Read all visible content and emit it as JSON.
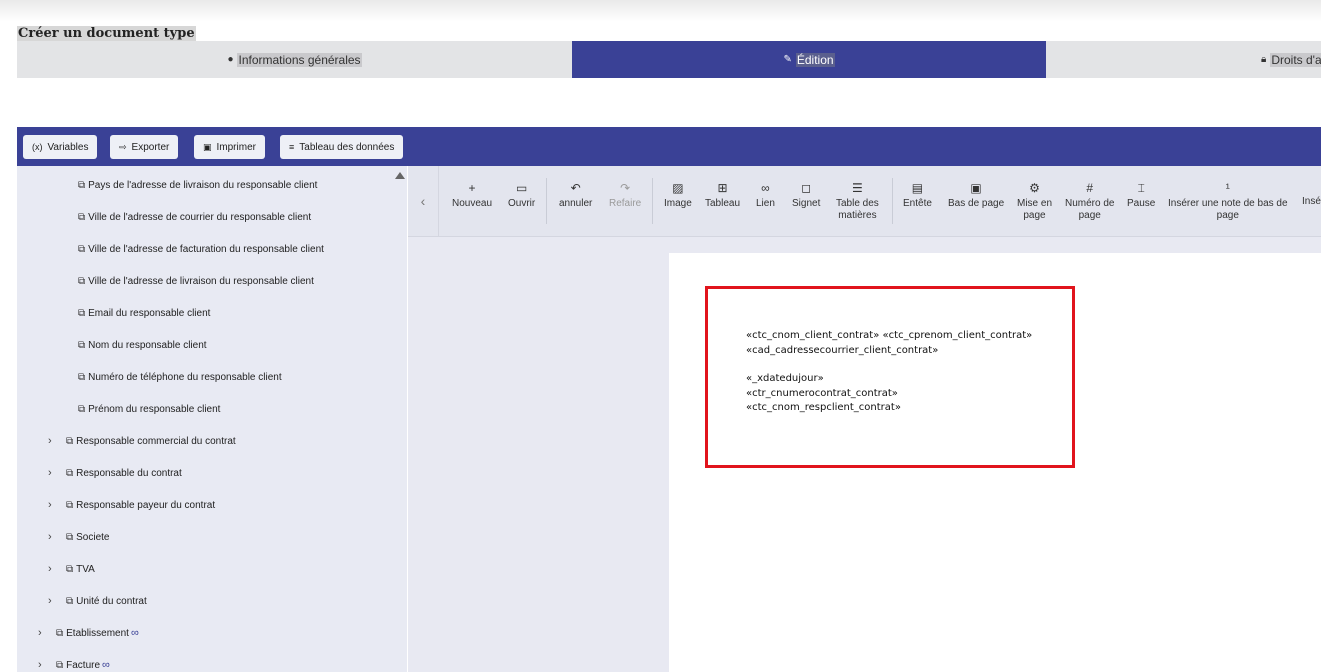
{
  "page_title": "Créer un document type",
  "tabs": {
    "info": "Informations générales",
    "edit": "Édition",
    "rights": "Droits d'a"
  },
  "toolbar": {
    "variables": "Variables",
    "exporter": "Exporter",
    "imprimer": "Imprimer",
    "tableau_donnees": "Tableau des données"
  },
  "sidebar": {
    "items": [
      {
        "label": "Pays de l'adresse de livraison du responsable client"
      },
      {
        "label": "Ville de l'adresse de courrier du responsable client"
      },
      {
        "label": "Ville de l'adresse de facturation du responsable client"
      },
      {
        "label": "Ville de l'adresse de livraison du responsable client"
      },
      {
        "label": "Email du responsable client"
      },
      {
        "label": "Nom du responsable client"
      },
      {
        "label": "Numéro de téléphone du responsable client"
      },
      {
        "label": "Prénom du responsable client"
      },
      {
        "label": "Responsable commercial du contrat"
      },
      {
        "label": "Responsable du contrat"
      },
      {
        "label": "Responsable payeur du contrat"
      },
      {
        "label": "Societe"
      },
      {
        "label": "TVA"
      },
      {
        "label": "Unité du contrat"
      },
      {
        "label": "Etablissement"
      },
      {
        "label": "Facture"
      }
    ]
  },
  "ribbon": {
    "nouveau": "Nouveau",
    "ouvrir": "Ouvrir",
    "annuler": "annuler",
    "refaire": "Refaire",
    "image": "Image",
    "tableau": "Tableau",
    "lien": "Lien",
    "signet": "Signet",
    "table_matieres_1": "Table des",
    "table_matieres_2": "matières",
    "entete": "Entête",
    "bas_page": "Bas de page",
    "mise_en_page_1": "Mise en",
    "mise_en_page_2": "page",
    "numero_page_1": "Numéro de",
    "numero_page_2": "page",
    "pause": "Pause",
    "note_bas_1": "Insérer une note de bas de",
    "note_bas_2": "page",
    "inse": "Insé"
  },
  "document": {
    "lines": [
      "«ctc_cnom_client_contrat» «ctc_cprenom_client_contrat»",
      "«cad_cadressecourrier_client_contrat»",
      "«_xdatedujour»",
      "«ctr_cnumerocontrat_contrat»",
      "«ctc_cnom_respclient_contrat»"
    ]
  },
  "colors": {
    "primary": "#3a4196",
    "highlight_border": "#e1141c",
    "sidebar_bg": "#e8eaf3"
  },
  "icons": {
    "variables": "variable-icon",
    "exporter": "export-icon",
    "imprimer": "print-icon",
    "tableau": "database-icon",
    "tree": "copy-icon",
    "expand": "chevron-right-icon",
    "infinity": "infinity-icon"
  }
}
